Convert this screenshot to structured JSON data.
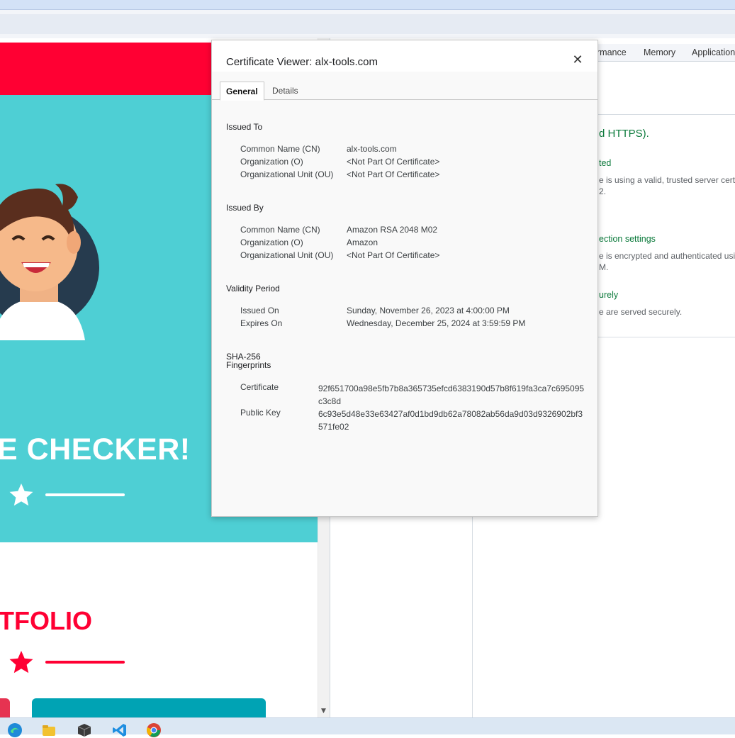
{
  "dialog": {
    "title": "Certificate Viewer: alx-tools.com",
    "close_glyph": "✕",
    "tabs": [
      {
        "label": "General",
        "active": true
      },
      {
        "label": "Details",
        "active": false
      }
    ],
    "issued_to": {
      "title": "Issued To",
      "rows": [
        {
          "key": "Common Name (CN)",
          "value": "alx-tools.com"
        },
        {
          "key": "Organization (O)",
          "value": "<Not Part Of Certificate>"
        },
        {
          "key": "Organizational Unit (OU)",
          "value": "<Not Part Of Certificate>"
        }
      ]
    },
    "issued_by": {
      "title": "Issued By",
      "rows": [
        {
          "key": "Common Name (CN)",
          "value": "Amazon RSA 2048 M02"
        },
        {
          "key": "Organization (O)",
          "value": "Amazon"
        },
        {
          "key": "Organizational Unit (OU)",
          "value": "<Not Part Of Certificate>"
        }
      ]
    },
    "validity": {
      "title": "Validity Period",
      "rows": [
        {
          "key": "Issued On",
          "value": "Sunday, November 26, 2023 at 4:00:00 PM"
        },
        {
          "key": "Expires On",
          "value": "Wednesday, December 25, 2024 at 3:59:59 PM"
        }
      ]
    },
    "fingerprints": {
      "title_line1": "SHA-256",
      "title_line2": "Fingerprints",
      "rows": [
        {
          "key": "Certificate",
          "value": "92f651700a98e5fb7b8a365735efcd6383190d57b8f619fa3ca7c695095c3c8d"
        },
        {
          "key": "Public Key",
          "value": "6c93e5d48e33e63427af0d1bd9db62a78082ab56da9d03d9326902bf3571fe02"
        }
      ]
    }
  },
  "devtools": {
    "tabs": [
      "rmance",
      "Memory",
      "Application"
    ],
    "security": {
      "headline": "d HTTPS).",
      "cert_title": "ted",
      "cert_desc_line1": "e is using a valid, trusted server certifi",
      "cert_desc_line2": "2.",
      "conn_title": "ection settings",
      "conn_desc_line1": "e is encrypted and authenticated usin",
      "conn_desc_line2": "M.",
      "res_title": "urely",
      "res_desc": "e are served securely."
    }
  },
  "site": {
    "hero_title": "E CHECKER!",
    "portfolio_title": "TFOLIO",
    "colors": {
      "red": "#ff0033",
      "teal": "#4ecfd4",
      "dark_teal": "#00a3b4",
      "pink": "#e63351"
    }
  },
  "taskbar": {
    "icons": [
      "edge-icon",
      "file-explorer-icon",
      "package-icon",
      "vscode-icon",
      "chrome-icon"
    ]
  }
}
